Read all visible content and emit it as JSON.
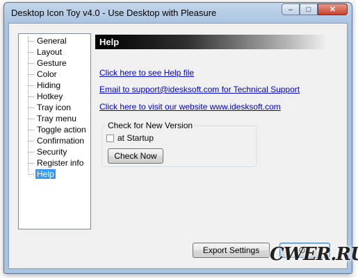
{
  "window": {
    "title": "Desktop Icon Toy v4.0 - Use Desktop with Pleasure",
    "controls": {
      "minimize": "–",
      "maximize": "□",
      "close": "✕"
    }
  },
  "tree": {
    "items": [
      {
        "label": "General",
        "selected": false
      },
      {
        "label": "Layout",
        "selected": false
      },
      {
        "label": "Gesture",
        "selected": false
      },
      {
        "label": "Color",
        "selected": false
      },
      {
        "label": "Hiding",
        "selected": false
      },
      {
        "label": "Hotkey",
        "selected": false
      },
      {
        "label": "Tray icon",
        "selected": false
      },
      {
        "label": "Tray menu",
        "selected": false
      },
      {
        "label": "Toggle action",
        "selected": false
      },
      {
        "label": "Confirmation",
        "selected": false
      },
      {
        "label": "Security",
        "selected": false
      },
      {
        "label": "Register info",
        "selected": false
      },
      {
        "label": "Help",
        "selected": true
      }
    ]
  },
  "panel": {
    "header": "Help",
    "links": {
      "help_file": "Click here to see Help file",
      "email": "Email to support@idesksoft.com for Technical Support",
      "website": "Click here to visit our website www.idesksoft.com"
    },
    "check_group": {
      "legend": "Check for New Version",
      "startup_label": "at Startup",
      "startup_checked": false,
      "check_now": "Check Now"
    }
  },
  "buttons": {
    "export": "Export Settings",
    "ok": "OK"
  },
  "watermark": "CWER.RU"
}
